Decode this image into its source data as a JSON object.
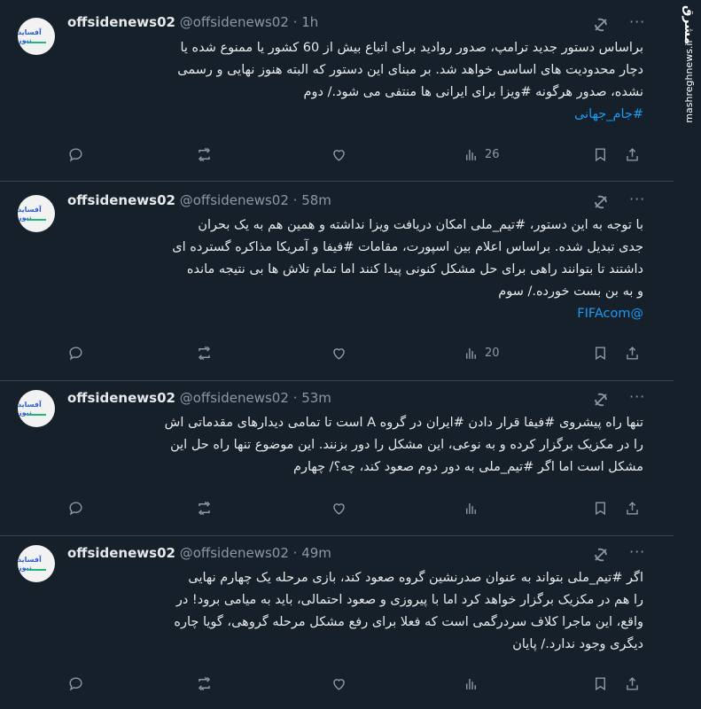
{
  "watermark": {
    "logo": "مشرق",
    "url": "mashreghnews.ir"
  },
  "tweets": [
    {
      "avatar_text": "آفساید نیوز",
      "name": "offsidenews02",
      "handle": "@offsidenews02 · 1h",
      "lines": [
        "براساس دستور جدید ترامپ، صدور روادید برای اتباع بیش از 60 کشور یا ممنوع شده یا",
        "دچار محدودیت های اساسی خواهد شد. بر مبنای این دستور که البته هنوز نهایی و رسمی",
        "نشده، صدور هرگونه #ویزا برای ایرانی ها منتفی می شود./ دوم",
        "#جام_جهانی"
      ],
      "views": "26"
    },
    {
      "avatar_text": "آفساید نیوز",
      "name": "offsidenews02",
      "handle": "@offsidenews02 · 58m",
      "lines": [
        "با توجه به این دستور، #تیم_ملی امکان دریافت ویزا نداشته و همین هم به یک بحران",
        "جدی تبدیل شده. براساس اعلام بین اسپورت، مقامات #فیفا و آمریکا مذاکره گسترده ای",
        "داشتند تا بتوانند راهی برای حل مشکل کنونی پیدا کنند اما تمام تلاش ها بی نتیجه مانده",
        "و به بن بست خورده./ سوم",
        "@FIFAcom"
      ],
      "views": "20"
    },
    {
      "avatar_text": "آفساید نیوز",
      "name": "offsidenews02",
      "handle": "@offsidenews02 · 53m",
      "lines": [
        "تنها راه پیشروی #فیفا قرار دادن #ایران در گروه A است تا تمامی دیدارهای مقدماتی اش",
        "را در مکزیک برگزار کرده و به نوعی، این مشکل را دور بزنند. این موضوع تنها راه حل این",
        "مشکل است اما اگر #تیم_ملی به دور دوم صعود کند، چه؟/ چهارم"
      ],
      "views": ""
    },
    {
      "avatar_text": "آفساید نیوز",
      "name": "offsidenews02",
      "handle": "@offsidenews02 · 49m",
      "lines": [
        "اگر #تیم_ملی بتواند به عنوان صدرنشین گروه صعود کند، بازی مرحله یک چهارم نهایی",
        "را هم در مکزیک برگزار خواهد کرد اما با پیروزی و صعود احتمالی، باید به میامی برود! در",
        "واقع، این ماجرا کلاف سردرگمی است که فعلا برای رفع مشکل مرحله گروهی، گویا چاره",
        "دیگری وجود ندارد./ پایان"
      ],
      "views": ""
    }
  ]
}
